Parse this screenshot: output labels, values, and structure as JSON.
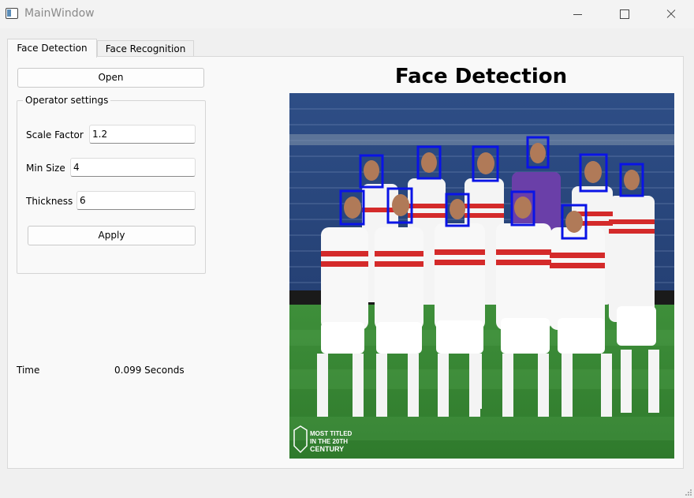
{
  "window": {
    "title": "MainWindow",
    "icon": "app-window-icon"
  },
  "tabs": [
    {
      "label": "Face Detection",
      "active": true
    },
    {
      "label": "Face Recognition",
      "active": false
    }
  ],
  "controls": {
    "open_label": "Open",
    "group_title": "Operator settings",
    "scale_factor_label": "Scale Factor",
    "scale_factor_value": "1.2",
    "min_size_label": "Min Size",
    "min_size_value": "4",
    "thickness_label": "Thickness",
    "thickness_value": "6",
    "apply_label": "Apply"
  },
  "result": {
    "time_label": "Time",
    "time_value": "0.099 Seconds"
  },
  "display": {
    "title": "Face Detection",
    "image_caption": "MOST TITLED IN THE 20TH CENTURY",
    "detection_box_color": "#0a14e6",
    "detected_faces_count": 12
  }
}
